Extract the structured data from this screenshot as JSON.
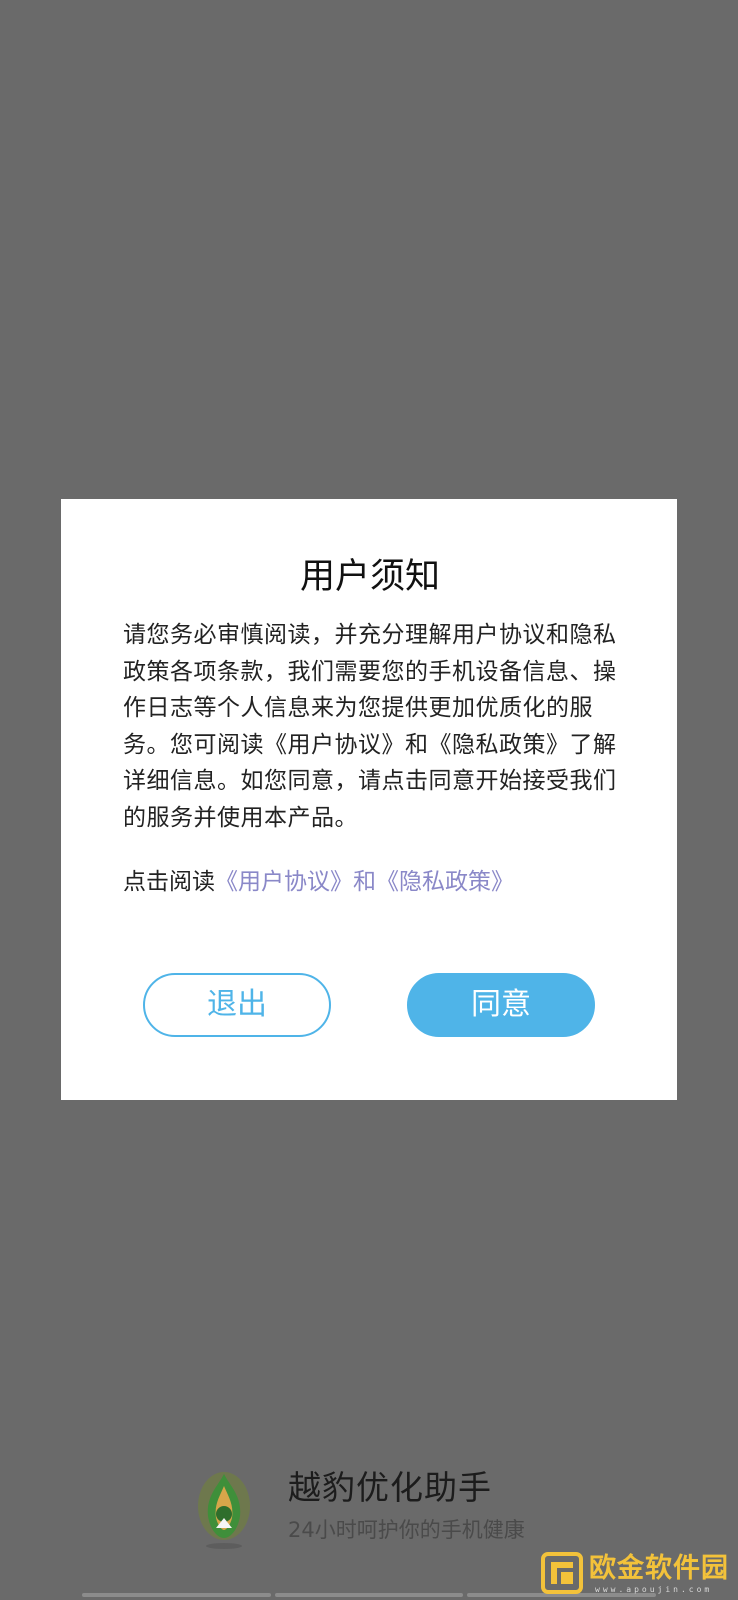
{
  "dialog": {
    "title": "用户须知",
    "body": "请您务必审慎阅读，并充分理解用户协议和隐私政策各项条款，我们需要您的手机设备信息、操作日志等个人信息来为您提供更加优质化的服务。您可阅读《用户协议》和《隐私政策》了解详细信息。如您同意，请点击同意开始接受我们的服务并使用本产品。",
    "read_prefix": "点击阅读",
    "user_agreement_link": "《用户协议》",
    "and_text": "和",
    "privacy_link": "《隐私政策》",
    "exit_label": "退出",
    "agree_label": "同意"
  },
  "brand": {
    "title": "越豹优化助手",
    "subtitle": "24小时呵护你的手机健康"
  },
  "watermark": {
    "text": "欧金软件园",
    "url": "www.apoujin.com"
  },
  "colors": {
    "overlay": "#6a6a6a",
    "accent": "#4fb4e8",
    "link": "#8a88c8",
    "watermark": "#f3c23a"
  }
}
